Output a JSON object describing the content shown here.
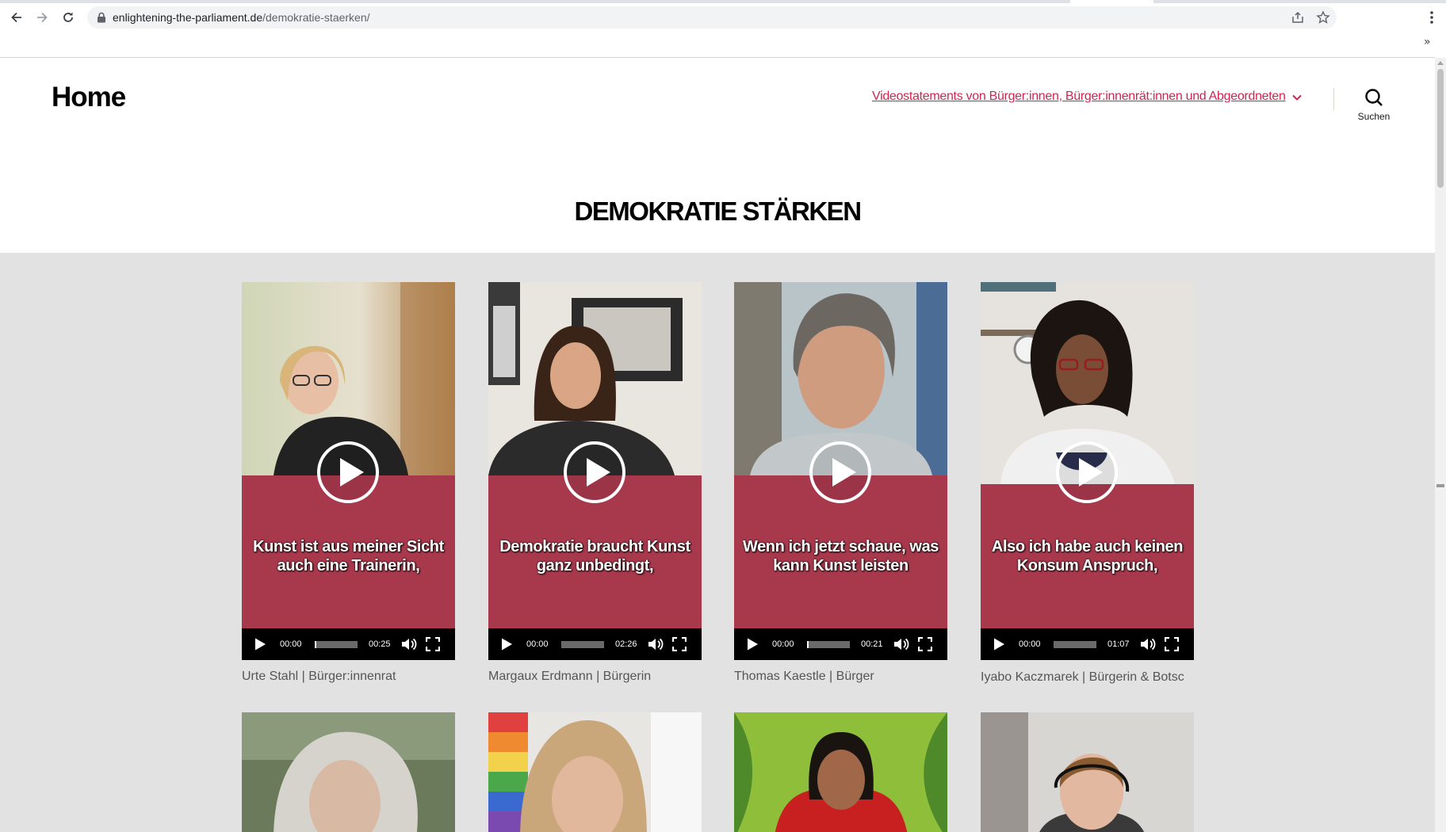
{
  "browser": {
    "url_host": "enlightening-the-parliament.de",
    "url_path": "/demokratie-staerken/",
    "back_icon": "arrow-left-icon",
    "forward_icon": "arrow-right-icon",
    "reload_icon": "reload-icon",
    "share_icon": "share-icon",
    "bookmark_icon": "star-icon",
    "menu_icon": "kebab-menu-icon",
    "extensions_label": "»"
  },
  "header": {
    "site_title": "Home",
    "nav_item": "Videostatements von Bürger:innen, Bürger:innenrät:innen und Abgeordneten",
    "search_label": "Suchen",
    "accent_color": "#cd2653"
  },
  "page": {
    "title": "DEMOKRATIE STÄRKEN",
    "background_color": "#e2e2e2",
    "video_panel_color": "#a8394c"
  },
  "videos": [
    {
      "caption": "Kunst ist aus meiner Sicht auch eine Trainerin,",
      "current": "00:00",
      "duration": "00:25",
      "label": "Urte Stahl | Bürger:innenrat"
    },
    {
      "caption": "Demokratie braucht Kunst ganz unbedingt,",
      "current": "00:00",
      "duration": "02:26",
      "label": "Margaux Erdmann | Bürgerin"
    },
    {
      "caption": "Wenn ich jetzt schaue, was kann Kunst leisten",
      "current": "00:00",
      "duration": "00:21",
      "label": "Thomas Kaestle | Bürger"
    },
    {
      "caption": "Also ich habe auch keinen Konsum Anspruch,",
      "current": "00:00",
      "duration": "01:07",
      "label": "Iyabo Kaczmarek | Bürgerin & Botsc"
    }
  ]
}
